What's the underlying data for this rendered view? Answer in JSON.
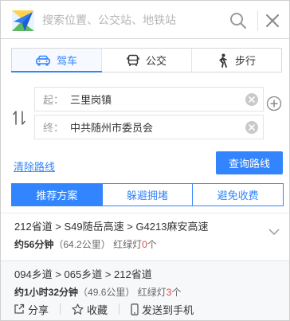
{
  "search": {
    "placeholder": "搜索位置、公交站、地铁站"
  },
  "mode_tabs": [
    {
      "label": "驾车",
      "icon": "car-icon",
      "active": true
    },
    {
      "label": "公交",
      "icon": "bus-icon",
      "active": false
    },
    {
      "label": "步行",
      "icon": "walk-icon",
      "active": false
    }
  ],
  "route_form": {
    "start_label": "起：",
    "start_value": "三里岗镇",
    "end_label": "终：",
    "end_value": "中共随州市委员会",
    "clear_link": "清除路线",
    "query_button": "查询路线"
  },
  "plan_tabs": [
    {
      "label": "推荐方案",
      "active": true
    },
    {
      "label": "躲避拥堵",
      "active": false
    },
    {
      "label": "避免收费",
      "active": false
    }
  ],
  "routes": [
    {
      "name": "212省道 > S49随岳高速 > G4213麻安高速",
      "duration": "约56分钟",
      "distance": "（64.2公里）",
      "lights_label": "红绿灯",
      "lights_count": "0",
      "lights_unit": "个"
    },
    {
      "name": "094乡道 > 065乡道 > 212省道",
      "duration": "约1小时32分钟",
      "distance": "（49.6公里）",
      "lights_label": "红绿灯",
      "lights_count": "3",
      "lights_unit": "个"
    }
  ],
  "actions": {
    "share": "分享",
    "favorite": "收藏",
    "send_phone": "发送到手机"
  },
  "colors": {
    "accent": "#3385ff",
    "lights": "#e64545"
  }
}
